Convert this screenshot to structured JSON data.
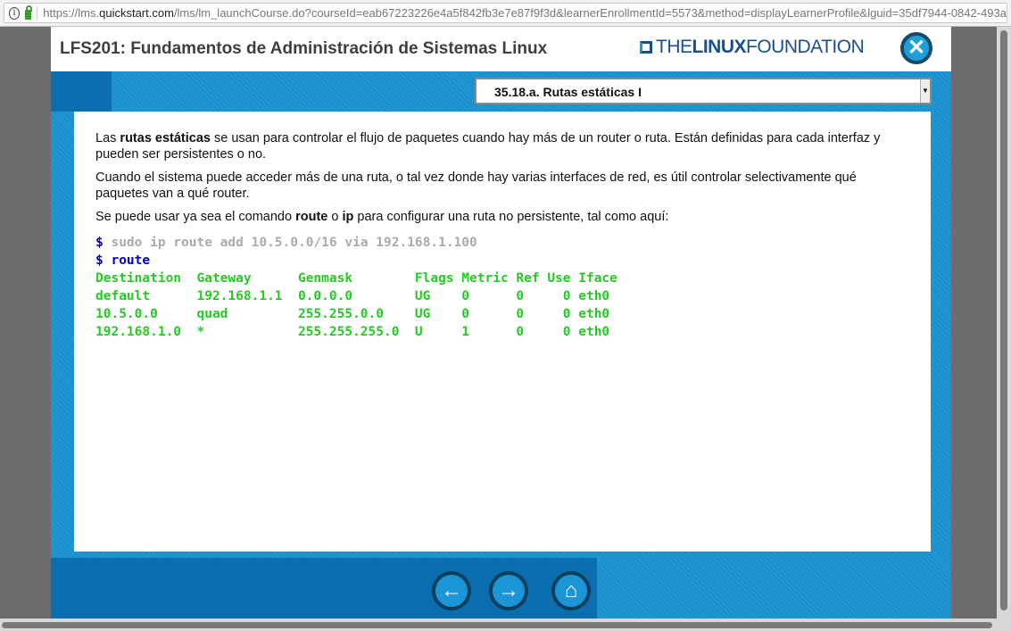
{
  "browser": {
    "url_prefix": "https://lms.",
    "url_host": "quickstart.com",
    "url_rest": "/lms/lm_launchCourse.do?courseId=eab67223226e4a5f842fb3e7e87f9f3d&learnerEnrollmentId=5573&method=displayLearnerProfile&lguid=35df7944-0842-493a"
  },
  "header": {
    "title": "LFS201: Fundamentos de Administración de Sistemas Linux",
    "logo_the": "THE",
    "logo_linux": "LINUX",
    "logo_foundation": "FOUNDATION",
    "close_icon": "close-icon"
  },
  "section_select": {
    "value": "35.18.a. Rutas estáticas I"
  },
  "content": {
    "p1_a": "Las ",
    "p1_b": "rutas estáticas",
    "p1_c": " se usan para controlar el flujo de paquetes cuando hay más de un router o ruta. Están definidas para cada interfaz y pueden ser persistentes o no.",
    "p2": "Cuando el sistema puede acceder más de una ruta, o tal vez donde hay varias interfaces de red, es útil controlar selectivamente qué paquetes van a qué router.",
    "p3_a": "Se puede usar ya sea el comando ",
    "p3_b": "route",
    "p3_c": " o ",
    "p3_d": "ip",
    "p3_e": " para configurar una ruta no persistente, tal como aquí:",
    "prompt": "$",
    "cmd1": "sudo ip route add 10.5.0.0/16 via 192.168.1.100",
    "cmd2": "route",
    "output": [
      "Destination  Gateway      Genmask        Flags Metric Ref Use Iface",
      "default      192.168.1.1  0.0.0.0        UG    0      0     0 eth0",
      "10.5.0.0     quad         255.255.0.0    UG    0      0     0 eth0",
      "192.168.1.0  *            255.255.255.0  U     1      0     0 eth0"
    ]
  },
  "nav": {
    "back": "←",
    "forward": "→",
    "home": "⌂"
  }
}
